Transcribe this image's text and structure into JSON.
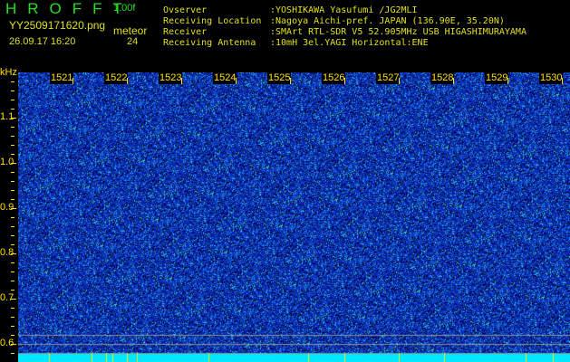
{
  "header": {
    "app_title": "HROFFT",
    "version": "1.00f",
    "filename": "YY2509171620.png",
    "datetime": "26.09.17 16:20",
    "mode_label": "meteor",
    "count": "24"
  },
  "info": [
    {
      "key": "Ovserver",
      "value": ":YOSHIKAWA Yasufumi /JG2MLI"
    },
    {
      "key": "Receiving Location",
      "value": ":Nagoya Aichi-pref. JAPAN (136.90E, 35.20N)"
    },
    {
      "key": "Receiver",
      "value": ":SMArt RTL-SDR V5 52.905MHz USB HIGASHIMURAYAMA"
    },
    {
      "key": "Receiving Antenna",
      "value": ":10mH 3el.YAGI Horizontal:ENE"
    }
  ],
  "waterfall": {
    "y_unit": "kHz",
    "y_ticks": [
      "1.1",
      "1.0",
      "0.9",
      "0.8",
      "0.7",
      "0.6"
    ],
    "x_ticks": [
      "1521",
      "1522",
      "1523",
      "1524",
      "1525",
      "1526",
      "1527",
      "1528",
      "1529",
      "1530"
    ],
    "colors": {
      "background": "#000000",
      "noise": "#1020c0",
      "band": "#00e8ff",
      "marker": "#ffe000",
      "label": "#ffe000"
    }
  }
}
